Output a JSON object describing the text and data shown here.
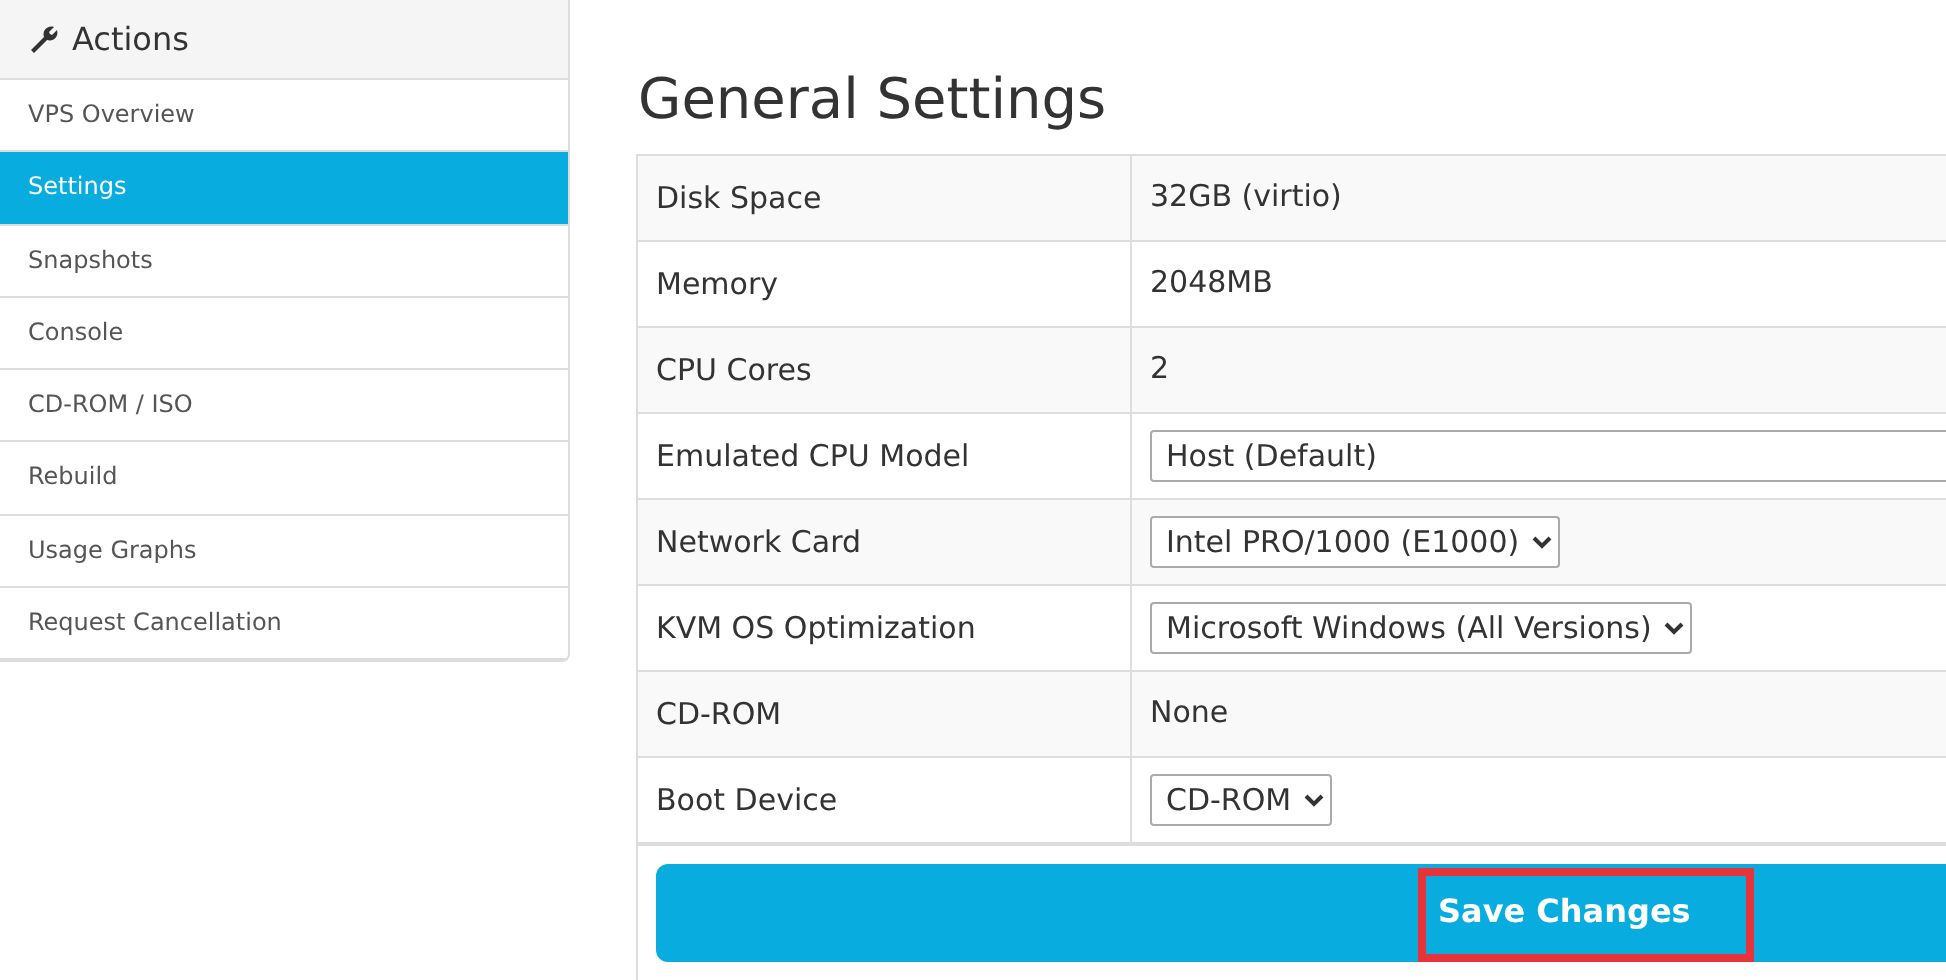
{
  "sidebar": {
    "title": "Actions",
    "items": [
      {
        "label": "VPS Overview",
        "selected": false
      },
      {
        "label": "Settings",
        "selected": true
      },
      {
        "label": "Snapshots",
        "selected": false
      },
      {
        "label": "Console",
        "selected": false
      },
      {
        "label": "CD-ROM / ISO",
        "selected": false
      },
      {
        "label": "Rebuild",
        "selected": false
      },
      {
        "label": "Usage Graphs",
        "selected": false
      },
      {
        "label": "Request Cancellation",
        "selected": false
      }
    ]
  },
  "heading": "General Settings",
  "settings": [
    {
      "label": "Disk Space",
      "kind": "text",
      "value": "32GB (virtio)"
    },
    {
      "label": "Memory",
      "kind": "text",
      "value": "2048MB"
    },
    {
      "label": "CPU Cores",
      "kind": "text",
      "value": "2"
    },
    {
      "label": "Emulated CPU Model",
      "kind": "wide-select",
      "value": "Host (Default)"
    },
    {
      "label": "Network Card",
      "kind": "select",
      "value": "Intel PRO/1000 (E1000)"
    },
    {
      "label": "KVM OS Optimization",
      "kind": "select",
      "value": "Microsoft Windows (All Versions)"
    },
    {
      "label": "CD-ROM",
      "kind": "text",
      "value": "None"
    },
    {
      "label": "Boot Device",
      "kind": "select",
      "value": "CD-ROM"
    }
  ],
  "save_button": {
    "label": "Save Changes",
    "highlighted": true
  }
}
